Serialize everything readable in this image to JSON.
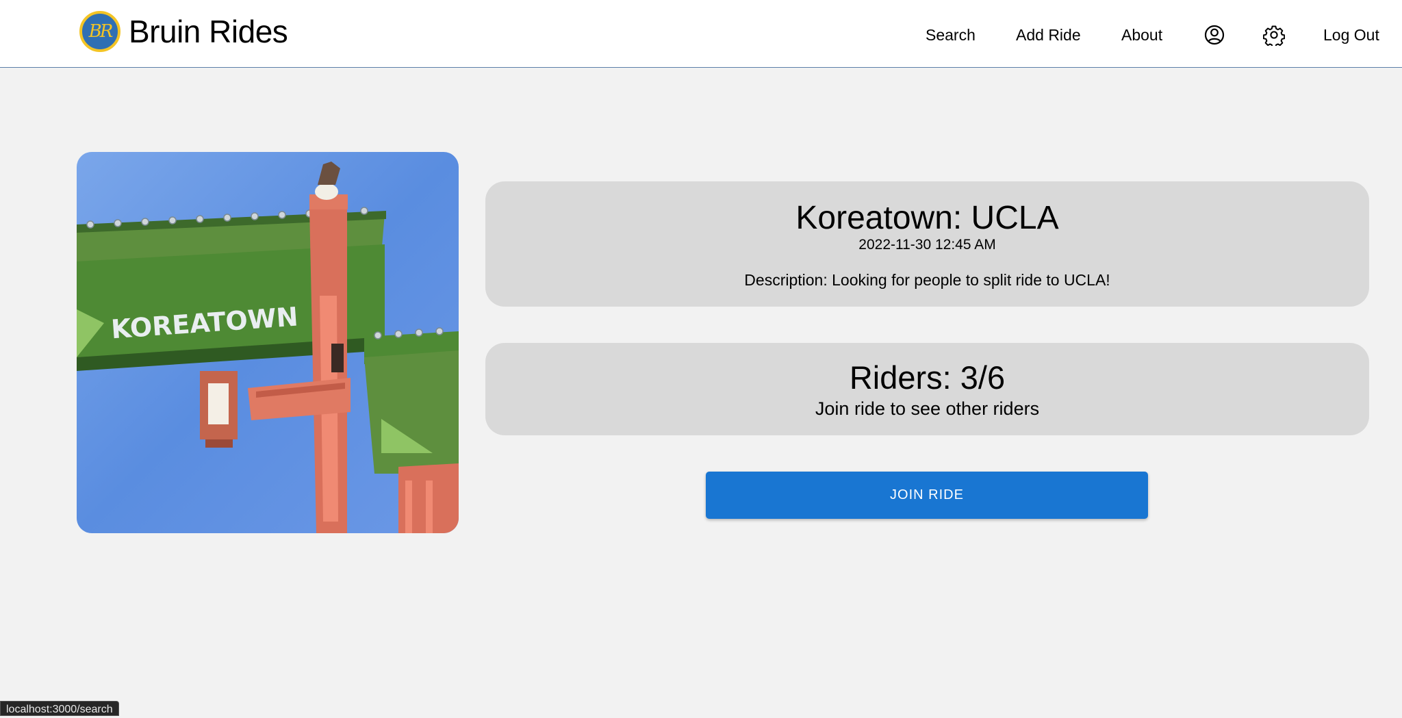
{
  "brand": {
    "title": "Bruin Rides",
    "logo_text": "BR"
  },
  "nav": {
    "search": "Search",
    "add_ride": "Add Ride",
    "about": "About",
    "profile_icon": "user-circle-icon",
    "settings_icon": "gear-icon",
    "logout": "Log Out"
  },
  "ride": {
    "image_sign_text": "KOREATOWN",
    "title": "Koreatown: UCLA",
    "datetime": "2022-11-30 12:45 AM",
    "description": "Description: Looking for people to split ride to UCLA!"
  },
  "riders": {
    "count": "Riders: 3/6",
    "hint": "Join ride to see other riders"
  },
  "actions": {
    "join": "JOIN RIDE"
  },
  "status_bar": {
    "url": "localhost:3000/search"
  },
  "colors": {
    "background": "#f2f2f2",
    "card": "#d9d9d9",
    "primary_button": "#1976d2",
    "logo_blue": "#2f6fb3",
    "logo_gold": "#f3c425"
  }
}
